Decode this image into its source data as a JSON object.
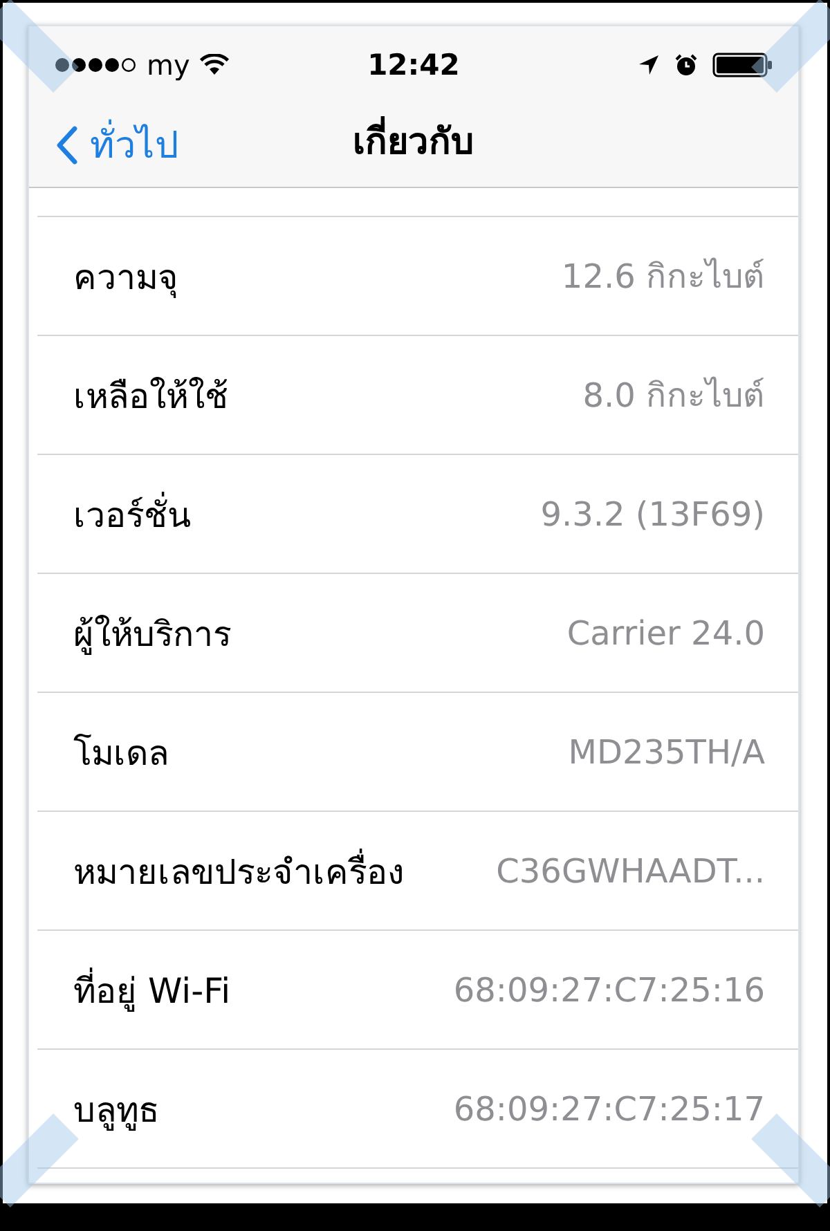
{
  "status_bar": {
    "carrier": "my",
    "time": "12:42"
  },
  "nav_bar": {
    "back": "ทั่วไป",
    "title": "เกี่ยวกับ"
  },
  "rows": [
    {
      "label": "ความจุ",
      "value": "12.6 กิกะไบต์"
    },
    {
      "label": "เหลือให้ใช้",
      "value": "8.0 กิกะไบต์"
    },
    {
      "label": "เวอร์ชั่น",
      "value": "9.3.2 (13F69)"
    },
    {
      "label": "ผู้ให้บริการ",
      "value": "Carrier 24.0"
    },
    {
      "label": "โมเดล",
      "value": "MD235TH/A"
    },
    {
      "label": "หมายเลขประจำเครื่อง",
      "value": "C36GWHAADT..."
    },
    {
      "label": "ที่อยู่ Wi-Fi",
      "value": "68:09:27:C7:25:16"
    },
    {
      "label": "บลูทูธ",
      "value": "68:09:27:C7:25:17"
    }
  ]
}
